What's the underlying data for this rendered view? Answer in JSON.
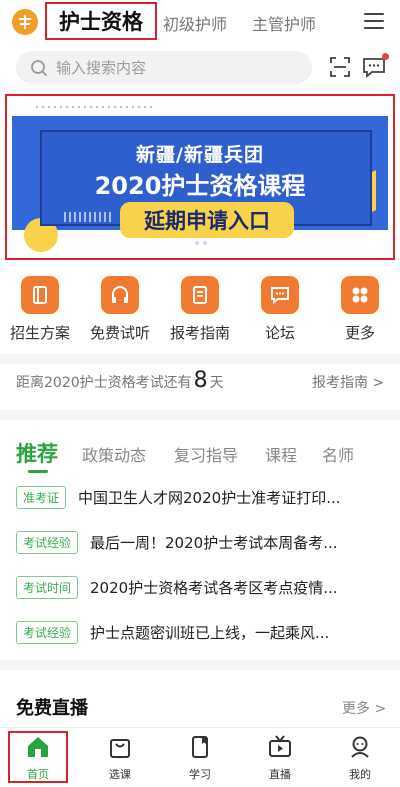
{
  "header": {
    "active_tab": "护士资格",
    "tabs": [
      "初级护师",
      "主管护师"
    ]
  },
  "search": {
    "placeholder": "输入搜索内容"
  },
  "banner": {
    "line1": "新疆/新疆兵团",
    "line2": "2020护士资格课程",
    "cta": "延期申请入口",
    "page_count": 3,
    "active_page": 1
  },
  "quick_links": [
    {
      "label": "招生方案",
      "icon": "book-icon"
    },
    {
      "label": "免费试听",
      "icon": "headphones-icon"
    },
    {
      "label": "报考指南",
      "icon": "notebook-icon"
    },
    {
      "label": "论坛",
      "icon": "chat-icon"
    },
    {
      "label": "更多",
      "icon": "grid-icon"
    }
  ],
  "countdown": {
    "prefix": "距离2020护士资格考试还有",
    "days": "8",
    "suffix": "天",
    "link": "报考指南 >"
  },
  "news_tabs": [
    "推荐",
    "政策动态",
    "复习指导",
    "课程",
    "名师"
  ],
  "news": [
    {
      "tag": "准考证",
      "title": "中国卫生人才网2020护士准考证打印..."
    },
    {
      "tag": "考试经验",
      "title": "最后一周！2020护士考试本周备考..."
    },
    {
      "tag": "考试时间",
      "title": "2020护士资格考试各考区考点疫情..."
    },
    {
      "tag": "考试经验",
      "title": "护士点题密训班已上线，一起乘风..."
    }
  ],
  "live": {
    "title": "免费直播",
    "more": "更多 >"
  },
  "bottom_nav": [
    {
      "label": "首页",
      "icon": "home-icon"
    },
    {
      "label": "选课",
      "icon": "shopping-bag-icon"
    },
    {
      "label": "学习",
      "icon": "book-icon"
    },
    {
      "label": "直播",
      "icon": "tv-icon"
    },
    {
      "label": "我的",
      "icon": "user-icon"
    }
  ],
  "colors": {
    "accent": "#2aa43f",
    "quick_icon": "#f07a32",
    "banner_blue": "#3467d8",
    "banner_yellow": "#f7d24a",
    "highlight_box": "#d9232a"
  }
}
